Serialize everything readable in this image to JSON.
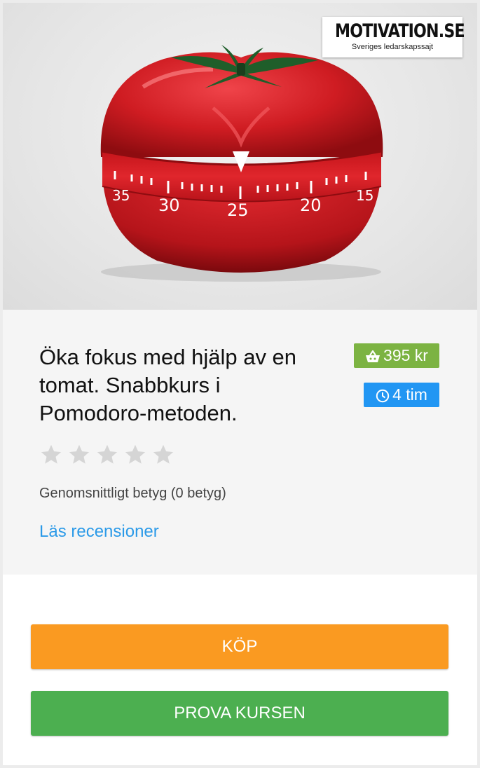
{
  "logo": {
    "title": "MOTIVATION.SE",
    "subtitle": "Sveriges ledarskapssajt"
  },
  "hero": {
    "dial_numbers": [
      "35",
      "30",
      "25",
      "20",
      "15"
    ]
  },
  "course": {
    "title": "Öka fokus med hjälp av en tomat. Snabbkurs i Pomodoro-metoden.",
    "price": "395 kr",
    "duration": "4 tim",
    "rating": {
      "stars_filled": 0,
      "stars_total": 5,
      "text": "Genomsnittligt betyg (0 betyg)"
    },
    "reviews_link": "Läs recensioner"
  },
  "actions": {
    "buy_label": "KÖP",
    "try_label": "PROVA KURSEN"
  },
  "colors": {
    "price_badge": "#7cb342",
    "time_badge": "#2196f3",
    "buy_button": "#fa9a21",
    "try_button": "#4caf50",
    "link": "#2b9ae8",
    "star_empty": "#d5d5d5"
  }
}
